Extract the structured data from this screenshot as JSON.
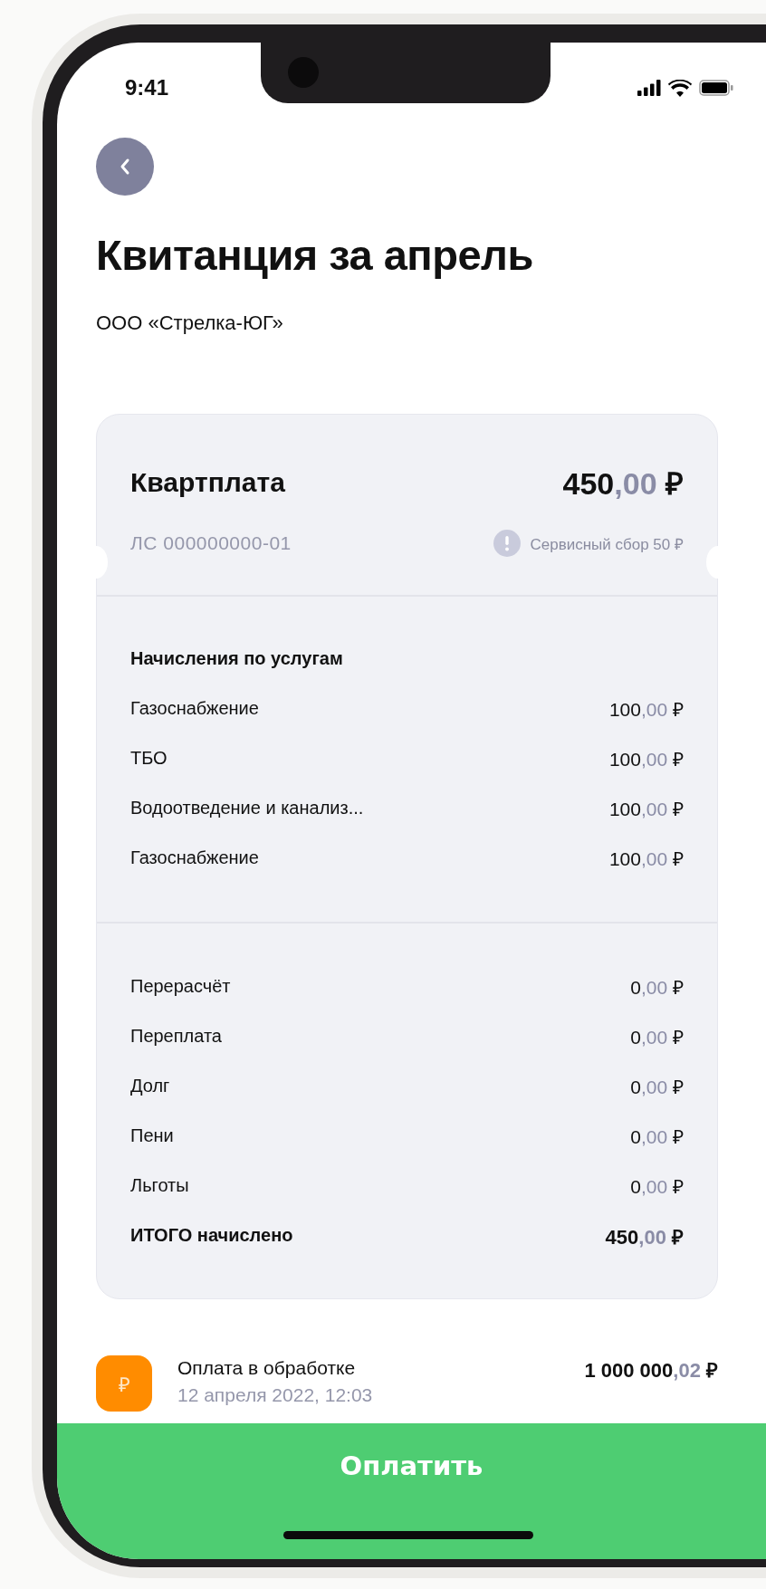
{
  "status_bar": {
    "time": "9:41"
  },
  "title": "Квитанция за апрель",
  "subtitle": "ООО «Стрелка-ЮГ»",
  "bill": {
    "name": "Квартплата",
    "total": {
      "whole": "450",
      "fraction": ",00",
      "currency": "₽"
    },
    "account": "ЛС 000000000-01",
    "fee": "Сервисный сбор 50 ₽",
    "sections": [
      {
        "title": "Начисления по услугам",
        "rows": [
          {
            "kind": "item",
            "label": "Газоснабжение",
            "amount": {
              "whole": "100",
              "fraction": ",00",
              "currency": "₽"
            }
          },
          {
            "kind": "item",
            "label": "ТБО",
            "amount": {
              "whole": "100",
              "fraction": ",00",
              "currency": "₽"
            }
          },
          {
            "kind": "item",
            "label": "Водоотведение и канализ...",
            "amount": {
              "whole": "100",
              "fraction": ",00",
              "currency": "₽"
            }
          },
          {
            "kind": "item",
            "label": "Газоснабжение",
            "amount": {
              "whole": "100",
              "fraction": ",00",
              "currency": "₽"
            }
          }
        ]
      },
      {
        "rows": [
          {
            "kind": "item",
            "label": "Перерасчёт",
            "amount": {
              "whole": "0",
              "fraction": ",00",
              "currency": "₽"
            }
          },
          {
            "kind": "item",
            "label": "Переплата",
            "amount": {
              "whole": "0",
              "fraction": ",00",
              "currency": "₽"
            }
          },
          {
            "kind": "item",
            "label": "Долг",
            "amount": {
              "whole": "0",
              "fraction": ",00",
              "currency": "₽"
            }
          },
          {
            "kind": "item",
            "label": "Пени",
            "amount": {
              "whole": "0",
              "fraction": ",00",
              "currency": "₽"
            }
          },
          {
            "kind": "item",
            "label": "Льготы",
            "amount": {
              "whole": "0",
              "fraction": ",00",
              "currency": "₽"
            }
          },
          {
            "kind": "total",
            "label": "ИТОГО начислено",
            "amount": {
              "whole": "450",
              "fraction": ",00",
              "currency": "₽"
            }
          }
        ]
      }
    ]
  },
  "payment": {
    "badge": "₽",
    "title": "Оплата в обработке",
    "date": "12 апреля 2022, 12:03",
    "amount": {
      "whole": "1 000 000",
      "fraction": ",02",
      "currency": "₽"
    }
  },
  "pay_button": "Оплатить"
}
